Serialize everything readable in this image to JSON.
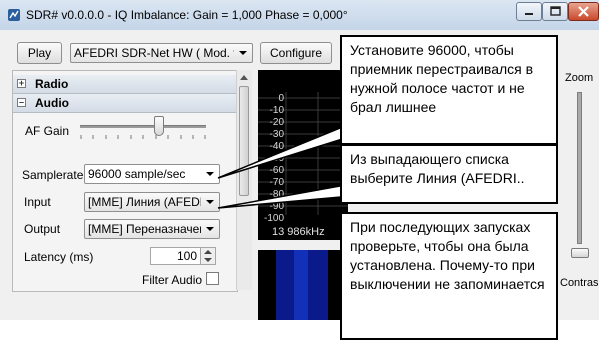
{
  "window": {
    "title": "SDR# v0.0.0.0 - IQ Imbalance: Gain = 1,000 Phase = 0,000°"
  },
  "toolbar": {
    "play_label": "Play",
    "device_value": "AFEDRI SDR-Net HW ( Mod. v) -",
    "configure_label": "Configure"
  },
  "sections": {
    "radio_label": "Radio",
    "audio_label": "Audio"
  },
  "audio": {
    "af_gain_label": "AF Gain",
    "af_gain_level": 0.63,
    "samplerate_label": "Samplerate",
    "samplerate_value": "96000 sample/sec",
    "input_label": "Input",
    "input_value": "[MME] Линия (AFEDRI",
    "output_label": "Output",
    "output_value": "[MME] Переназначени",
    "latency_label": "Latency (ms)",
    "latency_value": "100",
    "filter_audio_label": "Filter Audio"
  },
  "spectrum": {
    "db_ticks": [
      "0",
      "-10",
      "-20",
      "-30",
      "-40",
      "-50",
      "-60",
      "-70",
      "-80",
      "-90",
      "-100"
    ],
    "frequency_label": "13 986kHz"
  },
  "right_panel": {
    "zoom_label": "Zoom",
    "contrast_label": "Contras"
  },
  "callouts": [
    {
      "text": "Установите 96000, чтобы приемник перестраивался в нужной полосе частот и не брал лишнее"
    },
    {
      "text": "Из выпадающего списка выберите Линия (AFEDRI.."
    },
    {
      "text": "При последующих запусках проверьте, чтобы она была установлена. Почему-то при выключении не запоминается"
    }
  ],
  "colors": {
    "spectrum_bg": "#000000",
    "spectrum_grid": "#3a3a3a",
    "waterfall_blue": "#0a1a8a",
    "callout_border": "#000000"
  }
}
